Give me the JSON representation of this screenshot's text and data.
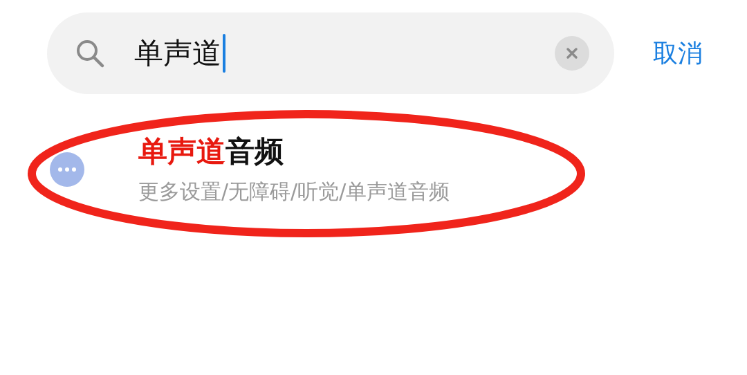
{
  "search": {
    "value": "单声道",
    "focused": true,
    "cancel": "取消"
  },
  "results": [
    {
      "title_parts": [
        {
          "text": "单声道",
          "highlighted": true
        },
        {
          "text": "音频",
          "highlighted": false
        }
      ],
      "path": "更多设置/无障碍/听觉/单声道音频",
      "circled": true
    }
  ]
}
